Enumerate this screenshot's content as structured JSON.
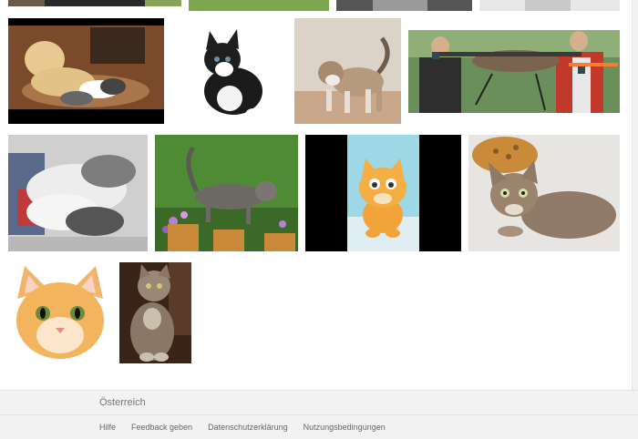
{
  "footer": {
    "region": "Österreich",
    "links": [
      "Hilfe",
      "Feedback geben",
      "Datenschutzerklärung",
      "Nutzungsbedingungen"
    ]
  },
  "colors": {
    "footer_bg": "#f2f2f2",
    "footer_text": "#666666"
  }
}
